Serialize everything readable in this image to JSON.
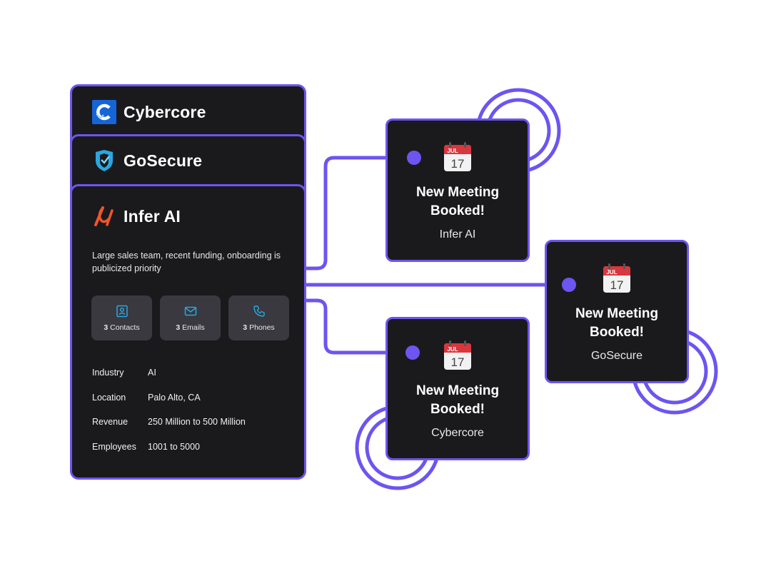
{
  "companies": [
    {
      "name": "Cybercore",
      "logo": "cybercore-logo"
    },
    {
      "name": "GoSecure",
      "logo": "gosecure-logo"
    },
    {
      "name": "Infer AI",
      "logo": "infer-ai-logo"
    }
  ],
  "active_company": {
    "description": "Large sales team, recent funding, onboarding is publicized priority",
    "stats": [
      {
        "count": "3",
        "label": "Contacts",
        "icon": "contact-card-icon"
      },
      {
        "count": "3",
        "label": "Emails",
        "icon": "envelope-icon"
      },
      {
        "count": "3",
        "label": "Phones",
        "icon": "phone-icon"
      }
    ],
    "details": [
      {
        "key": "Industry",
        "value": "AI"
      },
      {
        "key": "Location",
        "value": "Palo Alto, CA"
      },
      {
        "key": "Revenue",
        "value": "250 Million to 500 Million"
      },
      {
        "key": "Employees",
        "value": "1001 to 5000"
      }
    ]
  },
  "meetings": [
    {
      "title_line1": "New Meeting",
      "title_line2": "Booked!",
      "company": "Infer AI",
      "calendar_month": "JUL",
      "calendar_day": "17"
    },
    {
      "title_line1": "New Meeting",
      "title_line2": "Booked!",
      "company": "GoSecure",
      "calendar_month": "JUL",
      "calendar_day": "17"
    },
    {
      "title_line1": "New Meeting",
      "title_line2": "Booked!",
      "company": "Cybercore",
      "calendar_month": "JUL",
      "calendar_day": "17"
    }
  ],
  "colors": {
    "accent": "#6c55f0",
    "card": "#1a1a1d",
    "stat_tile": "#39393f",
    "icon_blue": "#2aa7e0",
    "calendar_red": "#d9363e"
  }
}
